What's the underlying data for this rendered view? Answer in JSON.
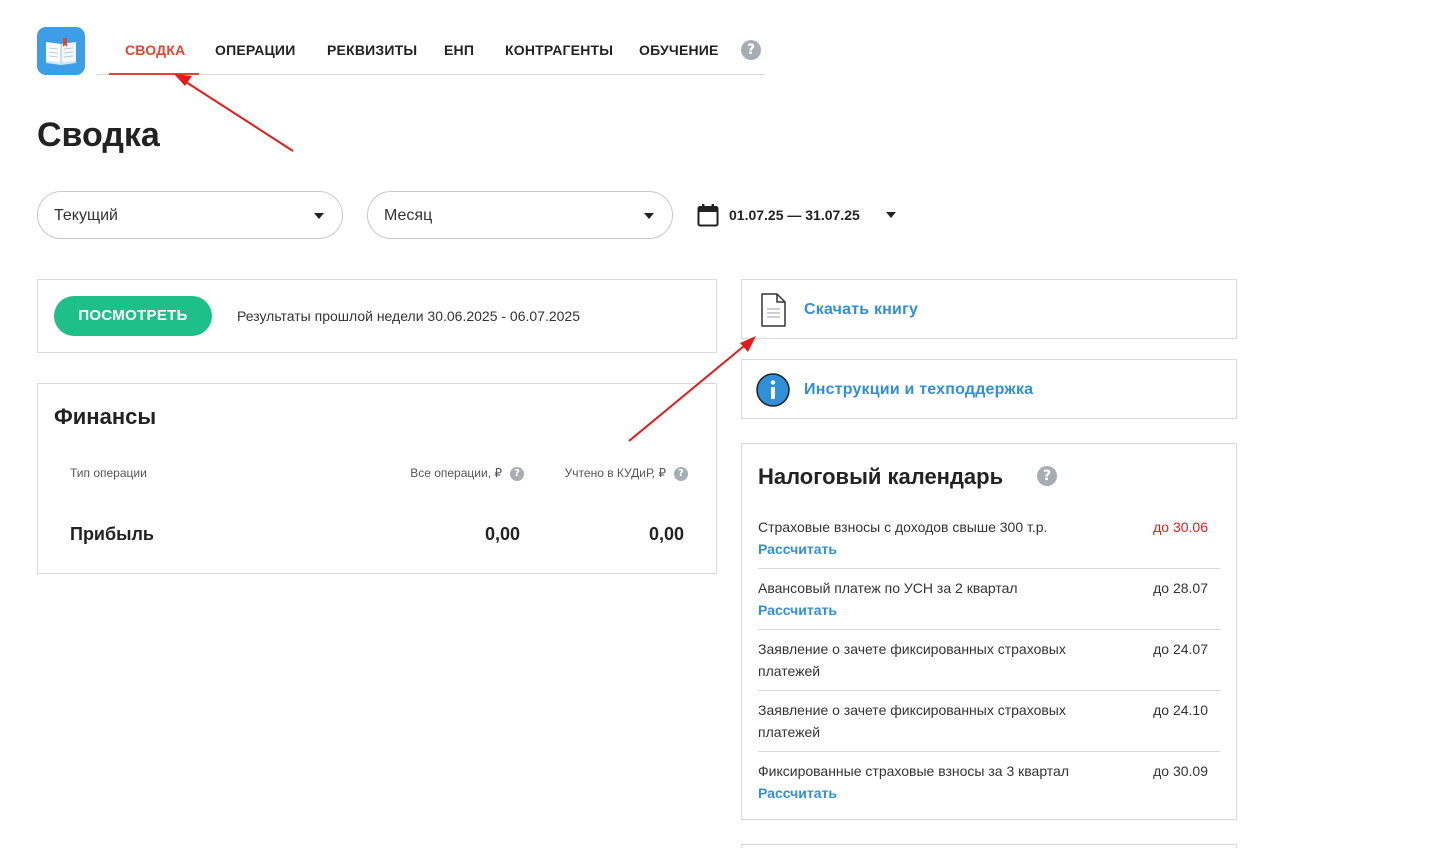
{
  "nav": {
    "tabs": [
      {
        "label": "СВОДКА",
        "active": true
      },
      {
        "label": "ОПЕРАЦИИ"
      },
      {
        "label": "РЕКВИЗИТЫ"
      },
      {
        "label": "ЕНП"
      },
      {
        "label": "КОНТРАГЕНТЫ"
      },
      {
        "label": "ОБУЧЕНИЕ"
      }
    ],
    "help_icon": "question-circle-icon",
    "help_glyph": "?"
  },
  "page": {
    "title": "Сводка"
  },
  "filters": {
    "period_type": "Текущий",
    "period_unit": "Месяц",
    "date_range": "01.07.25 — 31.07.25"
  },
  "weekly": {
    "button_label": "ПОСМОТРЕТЬ",
    "text": "Результаты прошлой недели 30.06.2025 - 06.07.2025"
  },
  "finance": {
    "title": "Финансы",
    "columns": {
      "type": "Тип операции",
      "all": "Все операции, ₽",
      "kudir": "Учтено в КУДиР, ₽"
    },
    "rows": [
      {
        "label": "Прибыль",
        "all": "0,00",
        "kudir": "0,00"
      }
    ]
  },
  "links": {
    "download_book": "Скачать книгу",
    "instructions": "Инструкции и техподдержка"
  },
  "tax_calendar": {
    "title": "Налоговый календарь",
    "calc_label": "Рассчитать",
    "items": [
      {
        "name": "Страховые взносы с доходов свыше 300 т.р.",
        "deadline": "до 30.06",
        "urgent": true,
        "has_link": true
      },
      {
        "name": "Авансовый платеж по УСН за 2 квартал",
        "deadline": "до 28.07",
        "urgent": false,
        "has_link": true
      },
      {
        "name": "Заявление о зачете фиксированных страховых платежей",
        "deadline": "до 24.07",
        "urgent": false,
        "has_link": false
      },
      {
        "name": "Заявление о зачете фиксированных страховых платежей",
        "deadline": "до 24.10",
        "urgent": false,
        "has_link": false
      },
      {
        "name": "Фиксированные страховые взносы за 3 квартал",
        "deadline": "до 30.09",
        "urgent": false,
        "has_link": true
      }
    ]
  },
  "colors": {
    "accent_red": "#e2452d",
    "button_green": "#1fbf8a",
    "link_blue": "#2f8fd8",
    "annotation_arrow": "#e21b1b"
  }
}
